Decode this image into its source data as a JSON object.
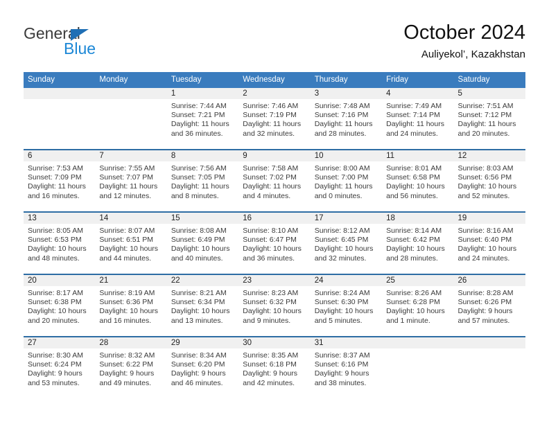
{
  "brand": {
    "name_top": "General",
    "name_bottom": "Blue",
    "triangle_icon": "blue-triangle-logo-mark",
    "color_top": "#3b3b3b",
    "color_bottom": "#1b87d6",
    "color_triangle": "#1f6fb5"
  },
  "header": {
    "title": "October 2024",
    "subtitle": "Auliyekol’, Kazakhstan"
  },
  "theme": {
    "header_row_bg": "#3a7cbe",
    "week_divider": "#2e6da4",
    "daynum_band_bg": "#f0f0f0",
    "text": "#3a3a3a"
  },
  "weekdays": [
    "Sunday",
    "Monday",
    "Tuesday",
    "Wednesday",
    "Thursday",
    "Friday",
    "Saturday"
  ],
  "weeks": [
    [
      {
        "day": "",
        "sunrise": "",
        "sunset": "",
        "daylight1": "",
        "daylight2": ""
      },
      {
        "day": "",
        "sunrise": "",
        "sunset": "",
        "daylight1": "",
        "daylight2": ""
      },
      {
        "day": "1",
        "sunrise": "Sunrise: 7:44 AM",
        "sunset": "Sunset: 7:21 PM",
        "daylight1": "Daylight: 11 hours",
        "daylight2": "and 36 minutes."
      },
      {
        "day": "2",
        "sunrise": "Sunrise: 7:46 AM",
        "sunset": "Sunset: 7:19 PM",
        "daylight1": "Daylight: 11 hours",
        "daylight2": "and 32 minutes."
      },
      {
        "day": "3",
        "sunrise": "Sunrise: 7:48 AM",
        "sunset": "Sunset: 7:16 PM",
        "daylight1": "Daylight: 11 hours",
        "daylight2": "and 28 minutes."
      },
      {
        "day": "4",
        "sunrise": "Sunrise: 7:49 AM",
        "sunset": "Sunset: 7:14 PM",
        "daylight1": "Daylight: 11 hours",
        "daylight2": "and 24 minutes."
      },
      {
        "day": "5",
        "sunrise": "Sunrise: 7:51 AM",
        "sunset": "Sunset: 7:12 PM",
        "daylight1": "Daylight: 11 hours",
        "daylight2": "and 20 minutes."
      }
    ],
    [
      {
        "day": "6",
        "sunrise": "Sunrise: 7:53 AM",
        "sunset": "Sunset: 7:09 PM",
        "daylight1": "Daylight: 11 hours",
        "daylight2": "and 16 minutes."
      },
      {
        "day": "7",
        "sunrise": "Sunrise: 7:55 AM",
        "sunset": "Sunset: 7:07 PM",
        "daylight1": "Daylight: 11 hours",
        "daylight2": "and 12 minutes."
      },
      {
        "day": "8",
        "sunrise": "Sunrise: 7:56 AM",
        "sunset": "Sunset: 7:05 PM",
        "daylight1": "Daylight: 11 hours",
        "daylight2": "and 8 minutes."
      },
      {
        "day": "9",
        "sunrise": "Sunrise: 7:58 AM",
        "sunset": "Sunset: 7:02 PM",
        "daylight1": "Daylight: 11 hours",
        "daylight2": "and 4 minutes."
      },
      {
        "day": "10",
        "sunrise": "Sunrise: 8:00 AM",
        "sunset": "Sunset: 7:00 PM",
        "daylight1": "Daylight: 11 hours",
        "daylight2": "and 0 minutes."
      },
      {
        "day": "11",
        "sunrise": "Sunrise: 8:01 AM",
        "sunset": "Sunset: 6:58 PM",
        "daylight1": "Daylight: 10 hours",
        "daylight2": "and 56 minutes."
      },
      {
        "day": "12",
        "sunrise": "Sunrise: 8:03 AM",
        "sunset": "Sunset: 6:56 PM",
        "daylight1": "Daylight: 10 hours",
        "daylight2": "and 52 minutes."
      }
    ],
    [
      {
        "day": "13",
        "sunrise": "Sunrise: 8:05 AM",
        "sunset": "Sunset: 6:53 PM",
        "daylight1": "Daylight: 10 hours",
        "daylight2": "and 48 minutes."
      },
      {
        "day": "14",
        "sunrise": "Sunrise: 8:07 AM",
        "sunset": "Sunset: 6:51 PM",
        "daylight1": "Daylight: 10 hours",
        "daylight2": "and 44 minutes."
      },
      {
        "day": "15",
        "sunrise": "Sunrise: 8:08 AM",
        "sunset": "Sunset: 6:49 PM",
        "daylight1": "Daylight: 10 hours",
        "daylight2": "and 40 minutes."
      },
      {
        "day": "16",
        "sunrise": "Sunrise: 8:10 AM",
        "sunset": "Sunset: 6:47 PM",
        "daylight1": "Daylight: 10 hours",
        "daylight2": "and 36 minutes."
      },
      {
        "day": "17",
        "sunrise": "Sunrise: 8:12 AM",
        "sunset": "Sunset: 6:45 PM",
        "daylight1": "Daylight: 10 hours",
        "daylight2": "and 32 minutes."
      },
      {
        "day": "18",
        "sunrise": "Sunrise: 8:14 AM",
        "sunset": "Sunset: 6:42 PM",
        "daylight1": "Daylight: 10 hours",
        "daylight2": "and 28 minutes."
      },
      {
        "day": "19",
        "sunrise": "Sunrise: 8:16 AM",
        "sunset": "Sunset: 6:40 PM",
        "daylight1": "Daylight: 10 hours",
        "daylight2": "and 24 minutes."
      }
    ],
    [
      {
        "day": "20",
        "sunrise": "Sunrise: 8:17 AM",
        "sunset": "Sunset: 6:38 PM",
        "daylight1": "Daylight: 10 hours",
        "daylight2": "and 20 minutes."
      },
      {
        "day": "21",
        "sunrise": "Sunrise: 8:19 AM",
        "sunset": "Sunset: 6:36 PM",
        "daylight1": "Daylight: 10 hours",
        "daylight2": "and 16 minutes."
      },
      {
        "day": "22",
        "sunrise": "Sunrise: 8:21 AM",
        "sunset": "Sunset: 6:34 PM",
        "daylight1": "Daylight: 10 hours",
        "daylight2": "and 13 minutes."
      },
      {
        "day": "23",
        "sunrise": "Sunrise: 8:23 AM",
        "sunset": "Sunset: 6:32 PM",
        "daylight1": "Daylight: 10 hours",
        "daylight2": "and 9 minutes."
      },
      {
        "day": "24",
        "sunrise": "Sunrise: 8:24 AM",
        "sunset": "Sunset: 6:30 PM",
        "daylight1": "Daylight: 10 hours",
        "daylight2": "and 5 minutes."
      },
      {
        "day": "25",
        "sunrise": "Sunrise: 8:26 AM",
        "sunset": "Sunset: 6:28 PM",
        "daylight1": "Daylight: 10 hours",
        "daylight2": "and 1 minute."
      },
      {
        "day": "26",
        "sunrise": "Sunrise: 8:28 AM",
        "sunset": "Sunset: 6:26 PM",
        "daylight1": "Daylight: 9 hours",
        "daylight2": "and 57 minutes."
      }
    ],
    [
      {
        "day": "27",
        "sunrise": "Sunrise: 8:30 AM",
        "sunset": "Sunset: 6:24 PM",
        "daylight1": "Daylight: 9 hours",
        "daylight2": "and 53 minutes."
      },
      {
        "day": "28",
        "sunrise": "Sunrise: 8:32 AM",
        "sunset": "Sunset: 6:22 PM",
        "daylight1": "Daylight: 9 hours",
        "daylight2": "and 49 minutes."
      },
      {
        "day": "29",
        "sunrise": "Sunrise: 8:34 AM",
        "sunset": "Sunset: 6:20 PM",
        "daylight1": "Daylight: 9 hours",
        "daylight2": "and 46 minutes."
      },
      {
        "day": "30",
        "sunrise": "Sunrise: 8:35 AM",
        "sunset": "Sunset: 6:18 PM",
        "daylight1": "Daylight: 9 hours",
        "daylight2": "and 42 minutes."
      },
      {
        "day": "31",
        "sunrise": "Sunrise: 8:37 AM",
        "sunset": "Sunset: 6:16 PM",
        "daylight1": "Daylight: 9 hours",
        "daylight2": "and 38 minutes."
      },
      {
        "day": "",
        "sunrise": "",
        "sunset": "",
        "daylight1": "",
        "daylight2": ""
      },
      {
        "day": "",
        "sunrise": "",
        "sunset": "",
        "daylight1": "",
        "daylight2": ""
      }
    ]
  ]
}
